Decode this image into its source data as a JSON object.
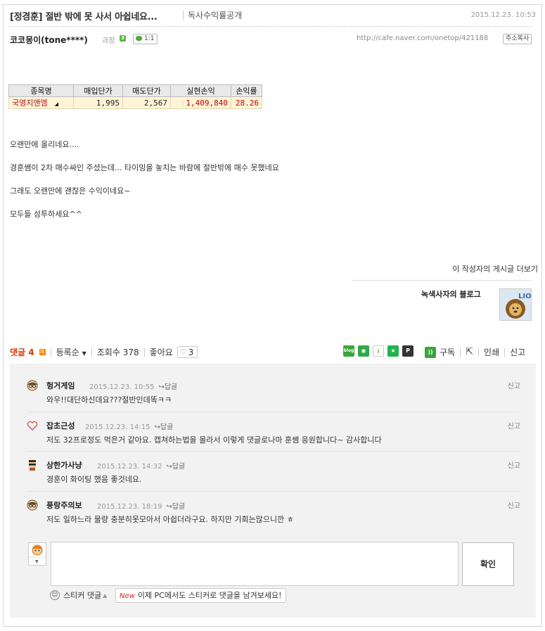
{
  "post": {
    "title": "[정경훈] 절반 밖에 못 사서 아쉽네요...",
    "category": "독사수익률공개",
    "date": "2015.12.23. 10:53",
    "author": "코코몽이(tone****)",
    "rank": "과장",
    "chat_label": "1:1",
    "url": "http://cafe.naver.com/onetop/421188",
    "copy_label": "주소복사"
  },
  "stock_table": {
    "headers": [
      "종목명",
      "매입단가",
      "매도단가",
      "실현손익",
      "손익률"
    ],
    "row": {
      "name": "국영지앤엠",
      "buy": "1,995",
      "sell": "2,567",
      "profit": "1,409,840",
      "rate": "28.26"
    }
  },
  "body_lines": [
    "오랜만에 올리네요....",
    "경훈쌤이 2차 매수싸인 주셨는데... 타이밍을 놓치는 바람에 절반밖에 매수 못했네요",
    "그래도 오랜만에 괜찮은 수익이네요~",
    "모두들 성투하세요^^"
  ],
  "author_more": "이 작성자의 게시글 더보기",
  "blog_name": "녹색사자의 블로그",
  "stats": {
    "comment_label": "댓글",
    "comment_count": "4",
    "sort_label": "등록순",
    "views_label": "조회수",
    "views": "378",
    "like_label": "좋아요",
    "likes": "3"
  },
  "tools": {
    "subscribe": "구독",
    "print": "인쇄",
    "report": "신고"
  },
  "comments": [
    {
      "nick": "헝거게임",
      "date": "2015.12.23. 10:55",
      "reply": "답글",
      "report": "신고",
      "text": "와우!!대단하신데요???절반인데똑ㅋㅋ",
      "avatar": "glasses-avatar-icon"
    },
    {
      "nick": "잡초근성",
      "date": "2015.12.23. 14:15",
      "reply": "답글",
      "report": "신고",
      "text": "저도 32프로정도 먹은거 같아요. 캡쳐하는법을 몰라서 이렇게 댓글로나마 훈쌤 응원합니다~ 감사합니다",
      "avatar": "heart-avatar-icon"
    },
    {
      "nick": "상한가사냥",
      "date": "2015.12.23. 14:32",
      "reply": "답글",
      "report": "신고",
      "text": "경훈이 화이팅 했음 좋것네요.",
      "avatar": "sunglasses-avatar-icon"
    },
    {
      "nick": "풍랑주의보",
      "date": "2015.12.23. 18:19",
      "reply": "답글",
      "report": "신고",
      "text": "저도 일하느라 물량 충분히못모아서 아쉽더라구요. 하지만 기회는많으니깐 ㅎ",
      "avatar": "glasses-avatar-icon"
    }
  ],
  "write": {
    "confirm": "확인",
    "sticker_label": "스티커 댓글",
    "new_badge": "New",
    "tip": "이제 PC에서도 스티커로 댓글을 남겨보세요!"
  },
  "colors": {
    "accent": "#d23a00",
    "table_row_bg": "#fff5d6",
    "profit_red": "#c00000",
    "panel_bg": "#f2f2f2"
  }
}
